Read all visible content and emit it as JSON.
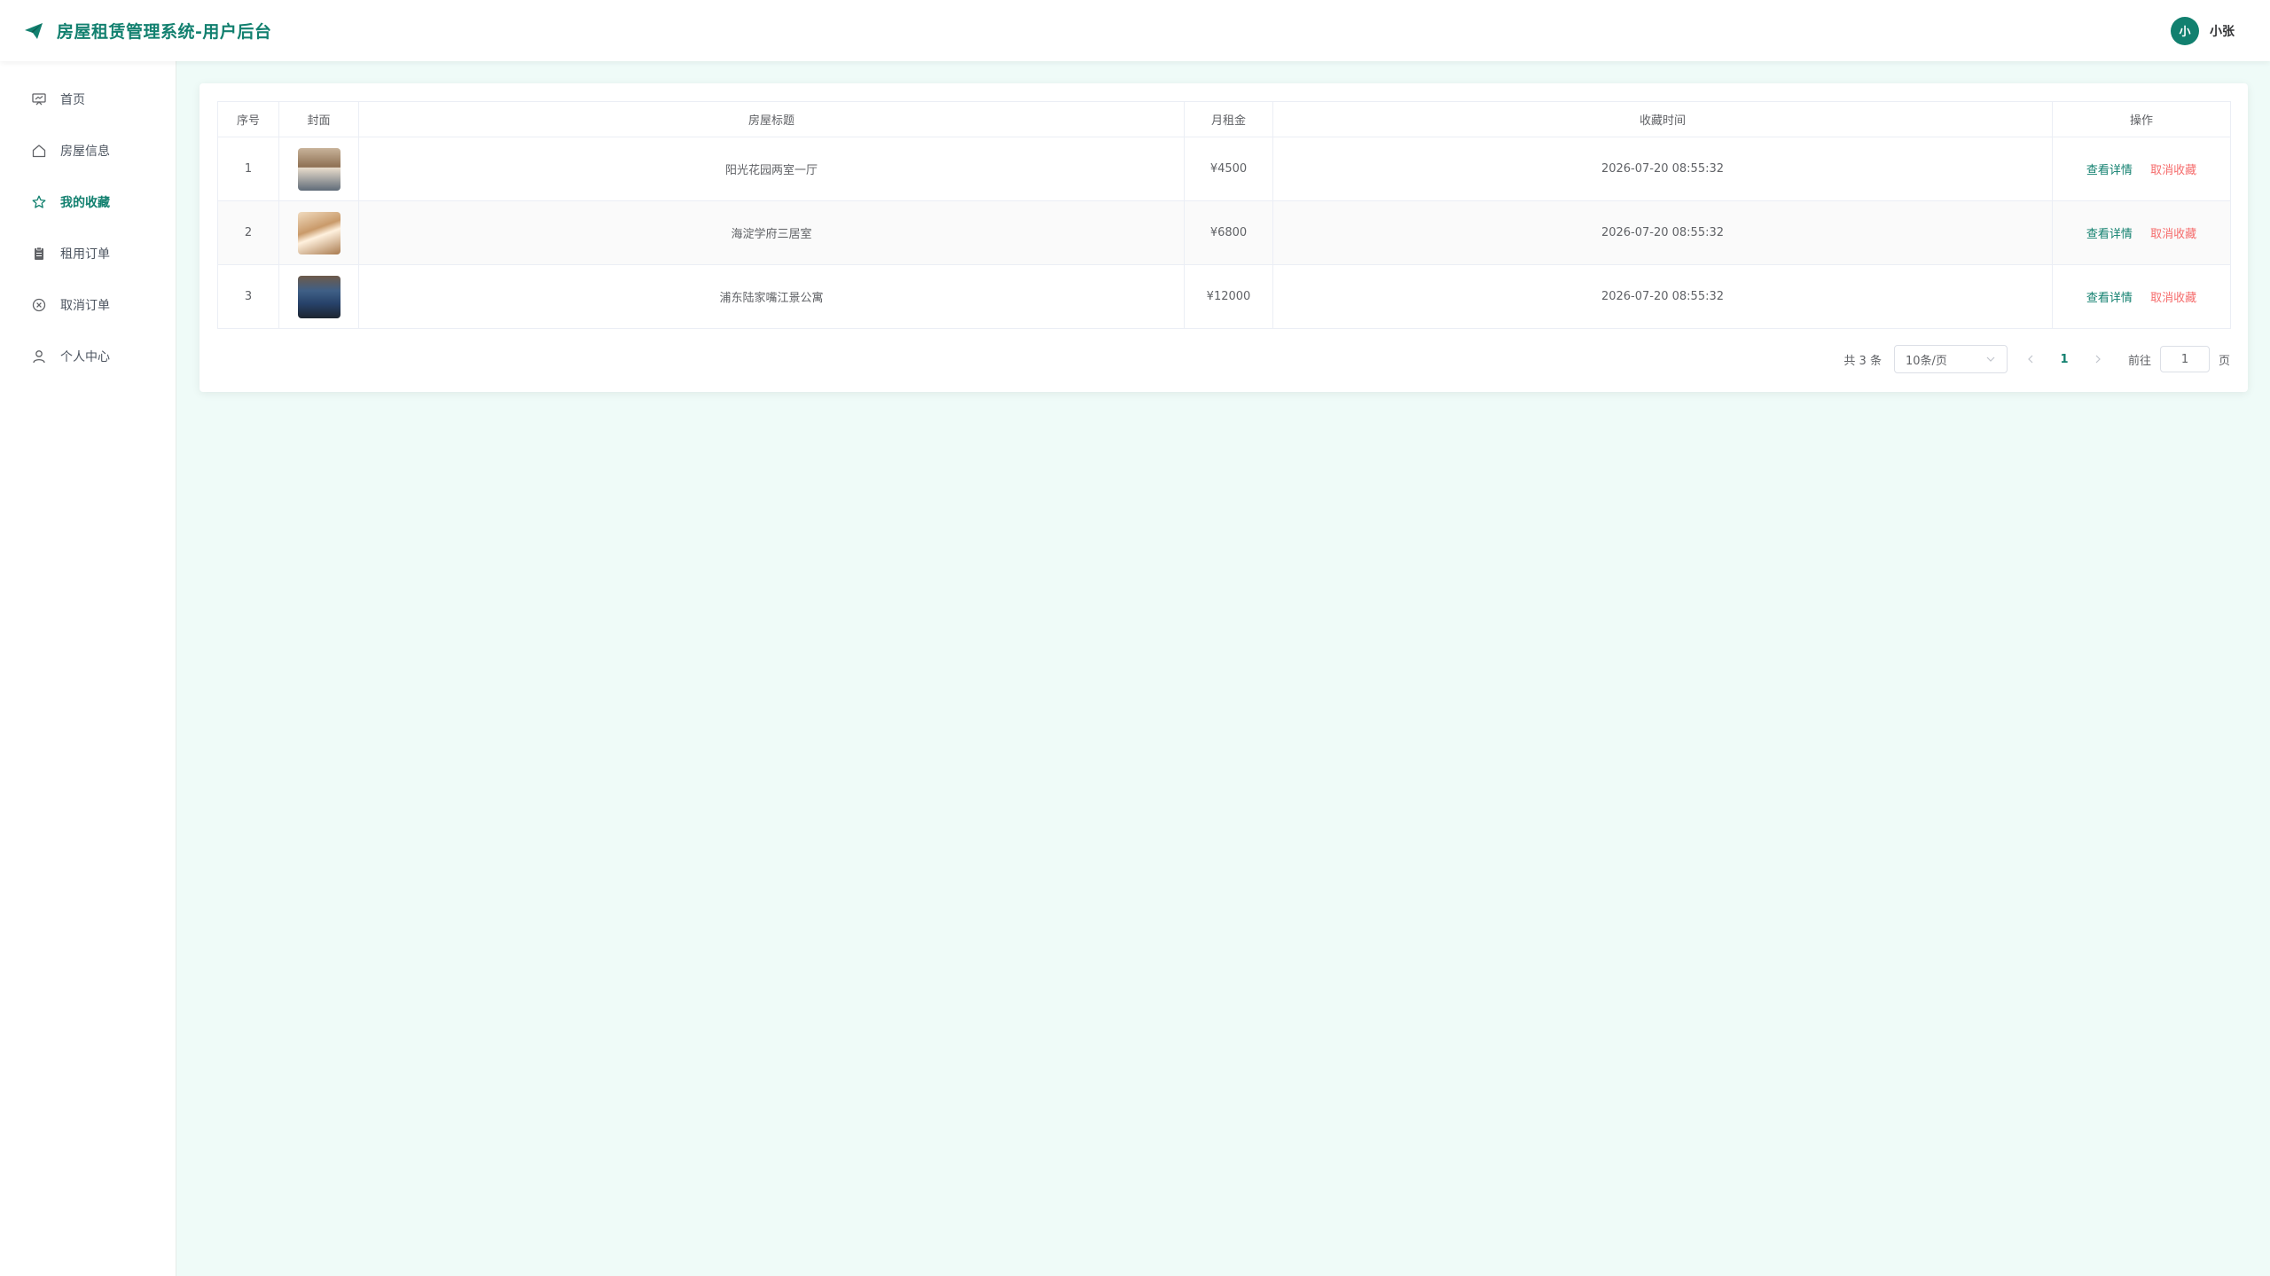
{
  "header": {
    "title": "房屋租赁管理系统-用户后台",
    "brand_icon": "paper-plane-icon",
    "avatar_text": "小",
    "username": "小张",
    "accent": "#12806f"
  },
  "sidebar": {
    "items": [
      {
        "label": "首页",
        "icon": "dashboard-icon",
        "active": false
      },
      {
        "label": "房屋信息",
        "icon": "house-icon",
        "active": false
      },
      {
        "label": "我的收藏",
        "icon": "star-icon",
        "active": true
      },
      {
        "label": "租用订单",
        "icon": "clipboard-icon",
        "active": false
      },
      {
        "label": "取消订单",
        "icon": "circle-close-icon",
        "active": false
      },
      {
        "label": "个人中心",
        "icon": "user-icon",
        "active": false
      }
    ]
  },
  "table": {
    "headers": {
      "index": "序号",
      "cover": "封面",
      "title": "房屋标题",
      "rent": "月租金",
      "time": "收藏时间",
      "ops": "操作"
    },
    "rows": [
      {
        "index": "1",
        "title": "阳光花园两室一厅",
        "rent": "¥4500",
        "time": "2026-07-20 08:55:32",
        "view": "查看详情",
        "cancel": "取消收藏"
      },
      {
        "index": "2",
        "title": "海淀学府三居室",
        "rent": "¥6800",
        "time": "2026-07-20 08:55:32",
        "view": "查看详情",
        "cancel": "取消收藏"
      },
      {
        "index": "3",
        "title": "浦东陆家嘴江景公寓",
        "rent": "¥12000",
        "time": "2026-07-20 08:55:32",
        "view": "查看详情",
        "cancel": "取消收藏"
      }
    ]
  },
  "pagination": {
    "total": "共 3 条",
    "page_size": "10条/页",
    "current_page": "1",
    "goto_label": "前往",
    "goto_value": "1",
    "page_suffix": "页"
  }
}
